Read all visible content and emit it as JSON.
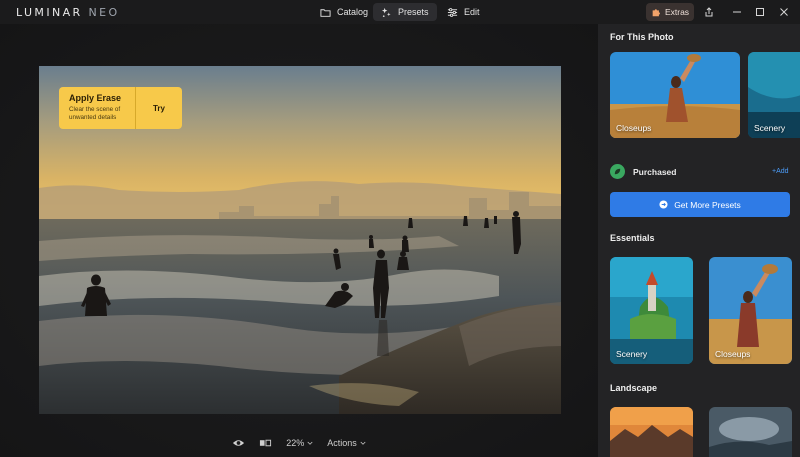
{
  "app": {
    "logo_main": "LUMINAR",
    "logo_sub": "NEO"
  },
  "nav": {
    "catalog": "Catalog",
    "presets": "Presets",
    "edit": "Edit",
    "active": "Presets"
  },
  "extras": {
    "label": "Extras"
  },
  "icons": {
    "catalog": "folder-icon",
    "presets": "sparkle-icon",
    "edit": "sliders-icon",
    "extras": "puzzle-icon",
    "share": "share-icon",
    "minimize": "minimize-icon",
    "maximize": "maximize-icon",
    "close": "close-icon",
    "eye": "eye-icon",
    "compare": "compare-icon",
    "chevron": "chevron-down-icon",
    "arrow": "arrow-right-icon",
    "purchased": "leaf-icon"
  },
  "tip": {
    "title": "Apply Erase",
    "description": "Clear the scene of unwanted details",
    "action": "Try"
  },
  "bottom": {
    "zoom": "22%",
    "actions": "Actions"
  },
  "panel": {
    "for_this_photo": {
      "title": "For This Photo",
      "cards": [
        {
          "label": "Closeups"
        },
        {
          "label": "Scenery"
        }
      ]
    },
    "purchased": {
      "label": "Purchased",
      "add": "+Add"
    },
    "get_more": {
      "label": "Get More Presets"
    },
    "essentials": {
      "title": "Essentials",
      "cards": [
        {
          "label": "Scenery"
        },
        {
          "label": "Closeups"
        }
      ]
    },
    "landscape": {
      "title": "Landscape"
    }
  },
  "colors": {
    "accent_blue": "#2f7be6",
    "tip_yellow": "#f7c94a",
    "panel_bg": "#232325",
    "app_bg": "#1b1b1c",
    "purchased_green": "#3aa860"
  }
}
